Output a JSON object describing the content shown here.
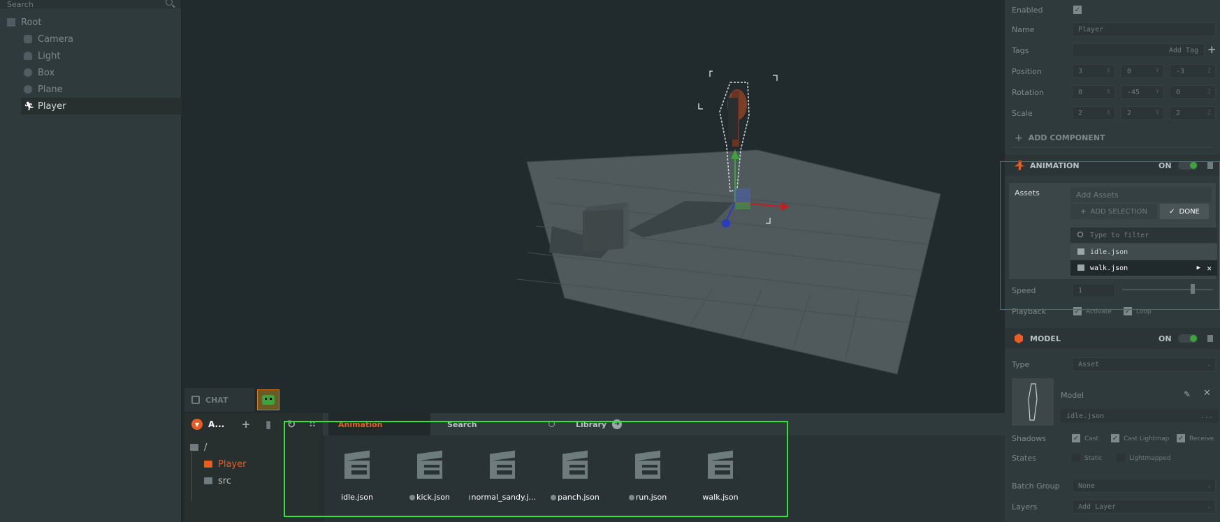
{
  "hierarchy": {
    "search_placeholder": "Search",
    "items": [
      {
        "label": "Root",
        "icon": "folder-icon"
      },
      {
        "label": "Camera",
        "icon": "camera-icon"
      },
      {
        "label": "Light",
        "icon": "light-icon"
      },
      {
        "label": "Box",
        "icon": "box-icon"
      },
      {
        "label": "Plane",
        "icon": "plane-icon"
      },
      {
        "label": "Player",
        "icon": "player-icon"
      }
    ]
  },
  "bottom": {
    "chat_label": "CHAT",
    "panel_title": "A...",
    "filter_type": "Animation",
    "search_label": "Search",
    "library_label": "Library",
    "folders": [
      {
        "label": "/"
      },
      {
        "label": "Player"
      },
      {
        "label": "src"
      }
    ],
    "assets": [
      {
        "name": "idle.json",
        "dot": false
      },
      {
        "name": "kick.json",
        "dot": true
      },
      {
        "name": "normal_sandy.j...",
        "dot": true
      },
      {
        "name": "panch.json",
        "dot": true
      },
      {
        "name": "run.json",
        "dot": true
      },
      {
        "name": "walk.json",
        "dot": false
      }
    ]
  },
  "inspector": {
    "enabled_label": "Enabled",
    "name_label": "Name",
    "name_value": "Player",
    "tags_label": "Tags",
    "tags_placeholder": "Add Tag",
    "position_label": "Position",
    "position": [
      "3",
      "0",
      "-3"
    ],
    "rotation_label": "Rotation",
    "rotation": [
      "0",
      "-45",
      "0"
    ],
    "scale_label": "Scale",
    "scale": [
      "2",
      "2",
      "2"
    ],
    "axes": [
      "X",
      "Y",
      "Z"
    ],
    "add_component": "ADD COMPONENT",
    "animation": {
      "title": "ANIMATION",
      "on": "ON",
      "assets_label": "Assets",
      "add_assets": "Add Assets",
      "add_selection": "ADD SELECTION",
      "done": "DONE",
      "filter_placeholder": "Type to filter",
      "entries": [
        "idle.json",
        "walk.json"
      ],
      "speed_label": "Speed",
      "speed_value": "1",
      "playback_label": "Playback",
      "activate_label": "Activate",
      "loop_label": "Loop"
    },
    "model": {
      "title": "MODEL",
      "on": "ON",
      "type_label": "Type",
      "type_value": "Asset",
      "model_label": "Model",
      "model_asset": "idle.json",
      "model_asset_more": "...",
      "shadows_label": "Shadows",
      "cast_label": "Cast",
      "cast_lightmap_label": "Cast Lightmap",
      "receive_label": "Receive",
      "states_label": "States",
      "static_label": "Static",
      "lightmapped_label": "Lightmapped",
      "batch_group_label": "Batch Group",
      "batch_group_value": "None",
      "layers_label": "Layers",
      "layers_placeholder": "Add Layer"
    }
  },
  "colors": {
    "accent": "#e85d23",
    "panel": "#2f3a3c",
    "highlight_green": "#2ee53a",
    "highlight_red": "#ff2020"
  }
}
